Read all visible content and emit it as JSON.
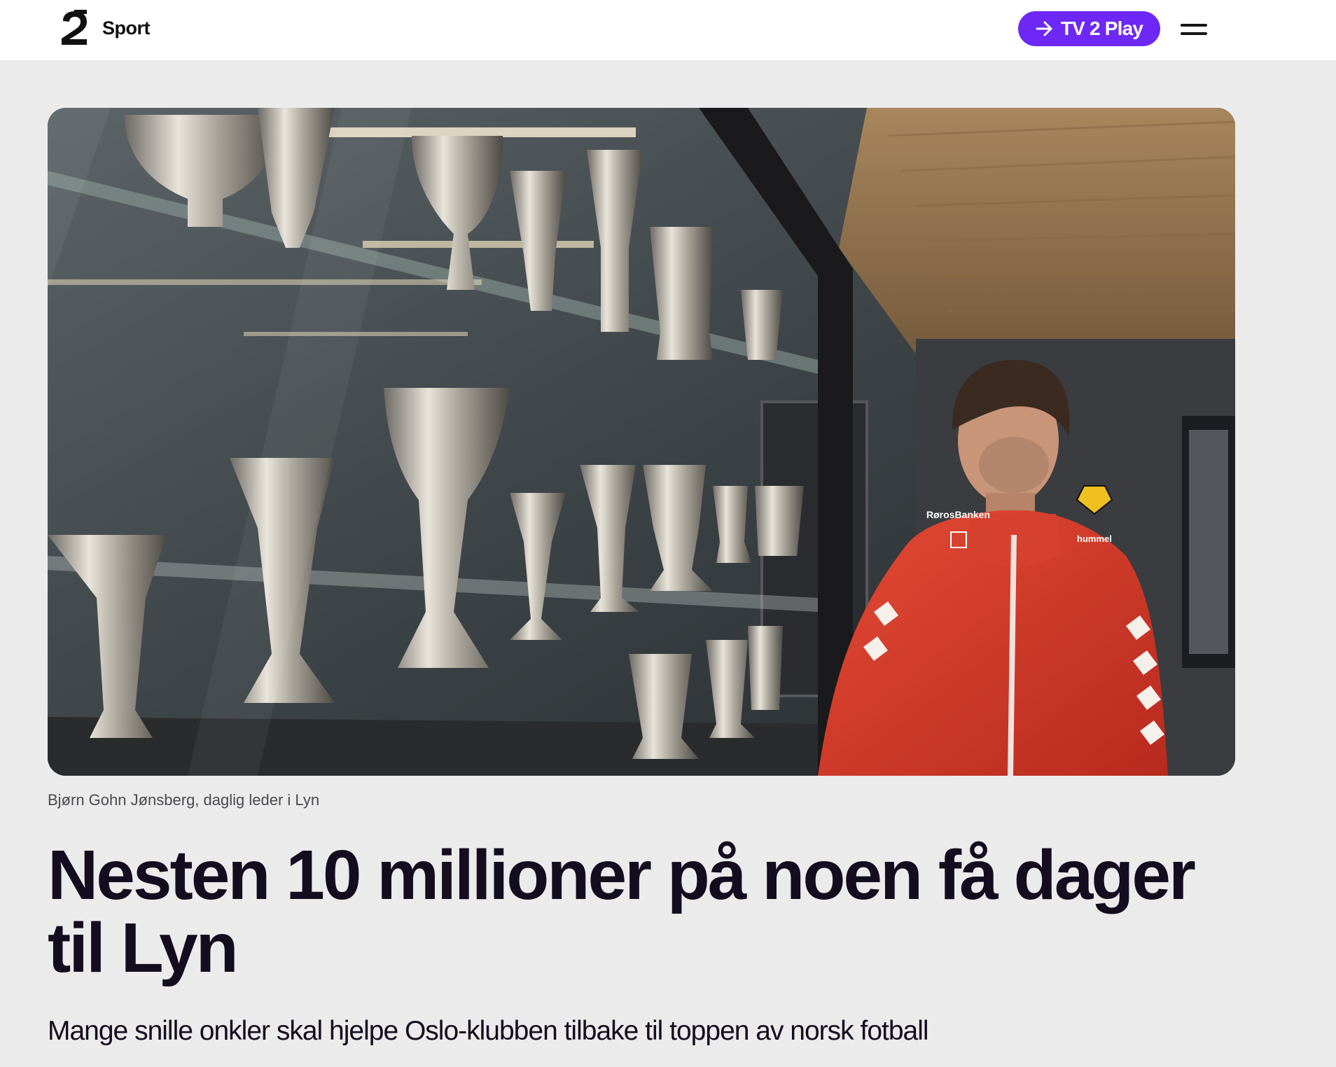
{
  "header": {
    "logo_icon": "tv2-logo-icon",
    "section_label": "Sport",
    "play_button_label": "TV 2 Play",
    "play_button_icon": "arrow-right-icon",
    "menu_icon": "hamburger-menu-icon",
    "accent_color": "#6d28f5"
  },
  "article": {
    "image_caption": "Bjørn Gohn Jønsberg, daglig leder i Lyn",
    "headline": "Nesten 10 millioner på noen få dager til Lyn",
    "lead": "Mange snille onkler skal hjelpe Oslo-klubben tilbake til toppen av norsk fotball"
  }
}
